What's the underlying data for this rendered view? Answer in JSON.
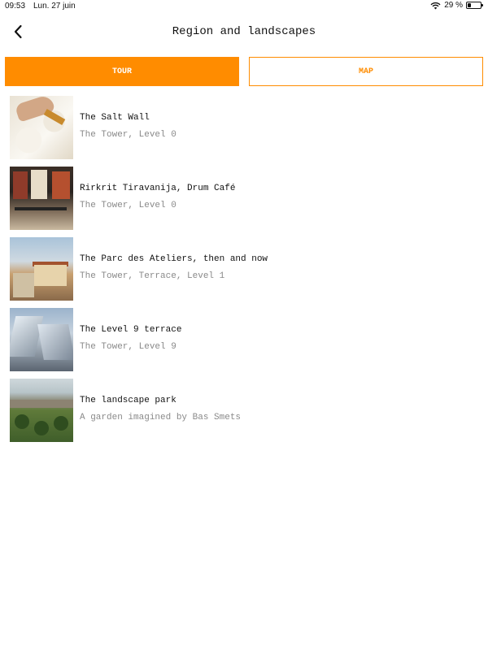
{
  "status_bar": {
    "time": "09:53",
    "date": "Lun. 27 juin",
    "battery": "29 %",
    "battery_level": 0.29
  },
  "header": {
    "title": "Region and landscapes",
    "back_icon": "chevron-left-icon"
  },
  "tabs": [
    {
      "label": "TOUR",
      "active": true
    },
    {
      "label": "MAP",
      "active": false
    }
  ],
  "colors": {
    "accent": "#ff8c00",
    "subtitle": "#8a8a8a"
  },
  "items": [
    {
      "title": "The Salt Wall",
      "subtitle": "The Tower, Level 0"
    },
    {
      "title": "Rirkrit Tiravanija, Drum Café",
      "subtitle": "The Tower, Level 0"
    },
    {
      "title": "The Parc des Ateliers, then and now",
      "subtitle": "The Tower, Terrace, Level 1"
    },
    {
      "title": "The Level 9 terrace",
      "subtitle": "The Tower, Level 9"
    },
    {
      "title": "The landscape park",
      "subtitle": "A garden imagined by Bas Smets"
    }
  ]
}
